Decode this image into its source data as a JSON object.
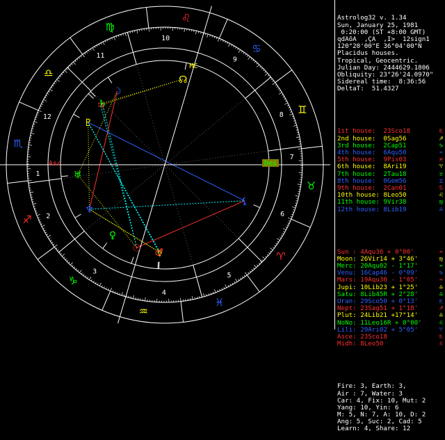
{
  "header": [
    "Astrolog32 v. 1.34",
    "Sun, January 25, 1981",
    " 0:20:00 (ST +8:00 GMT)",
    "qdÃõÂ  ,ÇÂ  ,Ï>  12sign1",
    "120°20'00\"E 36°04'00\"N",
    "Placidus houses.",
    "Tropical, Geocentric.",
    "Julian Day: 2444629.1806",
    "Obliquity: 23°26'24.0970\"",
    "Sidereal time:  8:36:56",
    "DeltaT:  51.4327"
  ],
  "houses": [
    {
      "text": "1st house:  23Sco18",
      "color": "#ff3030",
      "sym": "♏"
    },
    {
      "text": "2nd house:  0Sag56",
      "color": "#ffff00",
      "sym": "♐"
    },
    {
      "text": "3rd house:  2Cap51",
      "color": "#00ff00",
      "sym": "♑"
    },
    {
      "text": "4th house:  6Aqu50",
      "color": "#3060ff",
      "sym": "♒"
    },
    {
      "text": "5th house:  9Pis03",
      "color": "#ff3030",
      "sym": "♓"
    },
    {
      "text": "6th house:  8Ari19",
      "color": "#ffff00",
      "sym": "♈"
    },
    {
      "text": "7th house:  2Tau18",
      "color": "#00ff00",
      "sym": "♉"
    },
    {
      "text": "8th house:  0Gem56",
      "color": "#3060ff",
      "sym": "♊"
    },
    {
      "text": "9th house:  2Can01",
      "color": "#ff3030",
      "sym": "♋"
    },
    {
      "text": "10th house: 8Leo50",
      "color": "#ffff00",
      "sym": "♌"
    },
    {
      "text": "11th house: 9Vir38",
      "color": "#00ff00",
      "sym": "♍"
    },
    {
      "text": "12th house: 8Lib19",
      "color": "#3060ff",
      "sym": "♎"
    }
  ],
  "planets": [
    {
      "text": "Sun : 4Aqu36 + 0°00'",
      "color": "#ff3030",
      "sym": "♒"
    },
    {
      "text": "Moon: 26Vir14 + 3°46'",
      "color": "#ffff00",
      "sym": "♍"
    },
    {
      "text": "Merc: 20Aqu02 - 1°17'",
      "color": "#00ff00",
      "sym": "♒"
    },
    {
      "text": "Venu: 16Cap46 - 0°09'",
      "color": "#3060ff",
      "sym": "♑"
    },
    {
      "text": "Mars: 19Aqu30 - 1°05'",
      "color": "#ff3030",
      "sym": "♒"
    },
    {
      "text": "Jupi: 10Lib23 + 1°25'",
      "color": "#ffff00",
      "sym": "♎"
    },
    {
      "text": "Satu: 8Lib45R + 2°28'",
      "color": "#00ff00",
      "sym": "♎"
    },
    {
      "text": "Uran: 29Sco50 + 0°13'",
      "color": "#3060ff",
      "sym": "♏"
    },
    {
      "text": "Nept: 23Sag51 + 1°18'",
      "color": "#ff3030",
      "sym": "♐"
    },
    {
      "text": "Plut: 24Lib21 +17°14'",
      "color": "#ffff00",
      "sym": "♎"
    },
    {
      "text": "NoNo: 11Leo16R + 0°00'",
      "color": "#00ff00",
      "sym": "♌"
    },
    {
      "text": "Lili: 29Ari02 + 5°05'",
      "color": "#3060ff",
      "sym": "♈"
    },
    {
      "text": "Asce: 23Sco18",
      "color": "#ff3030",
      "sym": "♏"
    },
    {
      "text": "Midh: 8Leo50",
      "color": "#ff3030",
      "sym": "♌"
    }
  ],
  "footer": [
    "Fire: 3, Earth: 3,",
    "Air : 7, Water: 3",
    "Car: 4, Fix: 10, Mut: 2",
    "Yang: 10, Yin: 6",
    "M: 5, N: 7, A: 10, D: 2",
    "Ang: 5, Suc: 2, Cad: 5",
    "Learn: 4, Share: 12"
  ],
  "wheel": {
    "asc_degree": 233.3,
    "angle_labels": {
      "asc": "Asc",
      "des": "Des",
      "mc": "MC",
      "ic": "IC"
    },
    "sign_glyphs": [
      "♈",
      "♉",
      "♊",
      "♋",
      "♌",
      "♍",
      "♎",
      "♏",
      "♐",
      "♑",
      "♒",
      "♓"
    ],
    "element_colors": {
      "fire": "#ff3030",
      "earth": "#00ff00",
      "air": "#ffff00",
      "water": "#3060ff"
    },
    "house_cusps": [
      233.3,
      240.93,
      272.85,
      306.83,
      339.05,
      8.32,
      53.3,
      60.93,
      92.85,
      126.83,
      159.05,
      188.32
    ],
    "house_numbers": [
      "1",
      "2",
      "3",
      "4",
      "5",
      "6",
      "7",
      "8",
      "9",
      "10",
      "11",
      "12"
    ],
    "planets": [
      {
        "name": "Sun",
        "glyph": "☉",
        "lon": 304.6,
        "color": "#ff3030"
      },
      {
        "name": "Moon",
        "glyph": "☽",
        "lon": 176.23,
        "color": "#3060ff"
      },
      {
        "name": "Mercury",
        "glyph": "☿",
        "lon": 320.03,
        "color": "#ffff00"
      },
      {
        "name": "Venus",
        "glyph": "♀",
        "lon": 286.77,
        "color": "#00ff00"
      },
      {
        "name": "Mars",
        "glyph": "♂",
        "lon": 319.5,
        "color": "#ff3030"
      },
      {
        "name": "Jupiter",
        "glyph": "♃",
        "lon": 190.38,
        "color": "#ff3030"
      },
      {
        "name": "Saturn",
        "glyph": "♄",
        "lon": 188.75,
        "color": "#00ff00"
      },
      {
        "name": "Uranus",
        "glyph": "♅",
        "lon": 239.83,
        "color": "#00ff00"
      },
      {
        "name": "Neptune",
        "glyph": "♆",
        "lon": 263.85,
        "color": "#3060ff"
      },
      {
        "name": "Pluto",
        "glyph": "♇",
        "lon": 204.35,
        "color": "#ffff00"
      },
      {
        "name": "North Node",
        "glyph": "☊",
        "lon": 131.27,
        "color": "#ffff00"
      },
      {
        "name": "Lilith",
        "glyph": "⚸",
        "lon": 29.03,
        "color": "#3060ff"
      }
    ]
  }
}
